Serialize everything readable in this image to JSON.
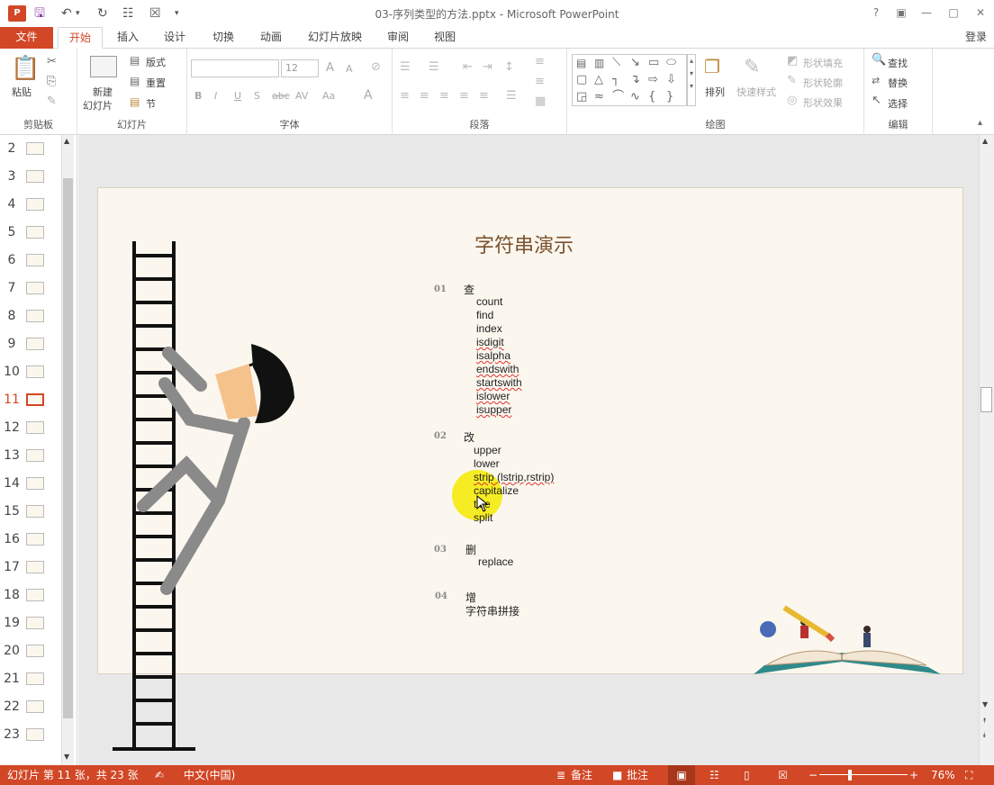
{
  "app": {
    "icon_letter": "P",
    "window_title": "03-序列类型的方法.pptx - Microsoft PowerPoint",
    "accent_color": "#d24726",
    "help_label": "?",
    "login_label": "登录"
  },
  "tabs": [
    "文件",
    "开始",
    "插入",
    "设计",
    "切换",
    "动画",
    "幻灯片放映",
    "审阅",
    "视图"
  ],
  "ribbon": {
    "clipboard": {
      "paste": "粘贴",
      "group": "剪贴板"
    },
    "slides": {
      "new_slide_1": "新建",
      "new_slide_2": "幻灯片",
      "layout": "版式",
      "reset": "重置",
      "section": "节",
      "group": "幻灯片"
    },
    "font": {
      "font_size": "12",
      "bold": "B",
      "italic": "I",
      "underline": "U",
      "shadow": "S",
      "strike": "abc",
      "spacing": "AV",
      "case": "Aa",
      "color": "A",
      "grow": "A",
      "shrink": "A",
      "group": "字体"
    },
    "paragraph": {
      "group": "段落"
    },
    "drawing": {
      "arrange": "排列",
      "quick_styles": "快速样式",
      "fill": "形状填充",
      "outline": "形状轮廓",
      "effects": "形状效果",
      "group": "绘图"
    },
    "editing": {
      "find": "查找",
      "replace": "替换",
      "select": "选择",
      "group": "编辑"
    }
  },
  "thumbnails": [
    {
      "num": "2"
    },
    {
      "num": "3"
    },
    {
      "num": "4"
    },
    {
      "num": "5"
    },
    {
      "num": "6"
    },
    {
      "num": "7"
    },
    {
      "num": "8"
    },
    {
      "num": "9"
    },
    {
      "num": "10"
    },
    {
      "num": "11"
    },
    {
      "num": "12"
    },
    {
      "num": "13"
    },
    {
      "num": "14"
    },
    {
      "num": "15"
    },
    {
      "num": "16"
    },
    {
      "num": "17"
    },
    {
      "num": "18"
    },
    {
      "num": "19"
    },
    {
      "num": "20"
    },
    {
      "num": "21"
    },
    {
      "num": "22"
    },
    {
      "num": "23"
    }
  ],
  "active_slide": "11",
  "slide": {
    "title": "字符串演示",
    "sections": [
      {
        "num": "01",
        "head": "查",
        "items": [
          "count",
          "find",
          "index",
          "isdigit",
          "isalpha",
          "endswith",
          "startswith",
          "islower",
          "isupper"
        ]
      },
      {
        "num": "02",
        "head": "改",
        "items": [
          "upper",
          "lower",
          "strip (lstrip,rstrip)",
          "capitalize",
          "title",
          "split"
        ]
      },
      {
        "num": "03",
        "head": "删",
        "items": [
          "replace"
        ]
      },
      {
        "num": "04",
        "head": "增",
        "items": [
          "字符串拼接"
        ]
      }
    ]
  },
  "status": {
    "slide_info": "幻灯片 第 11 张，共 23 张",
    "language": "中文(中国)",
    "notes": "备注",
    "comments": "批注",
    "zoom": "76%"
  }
}
